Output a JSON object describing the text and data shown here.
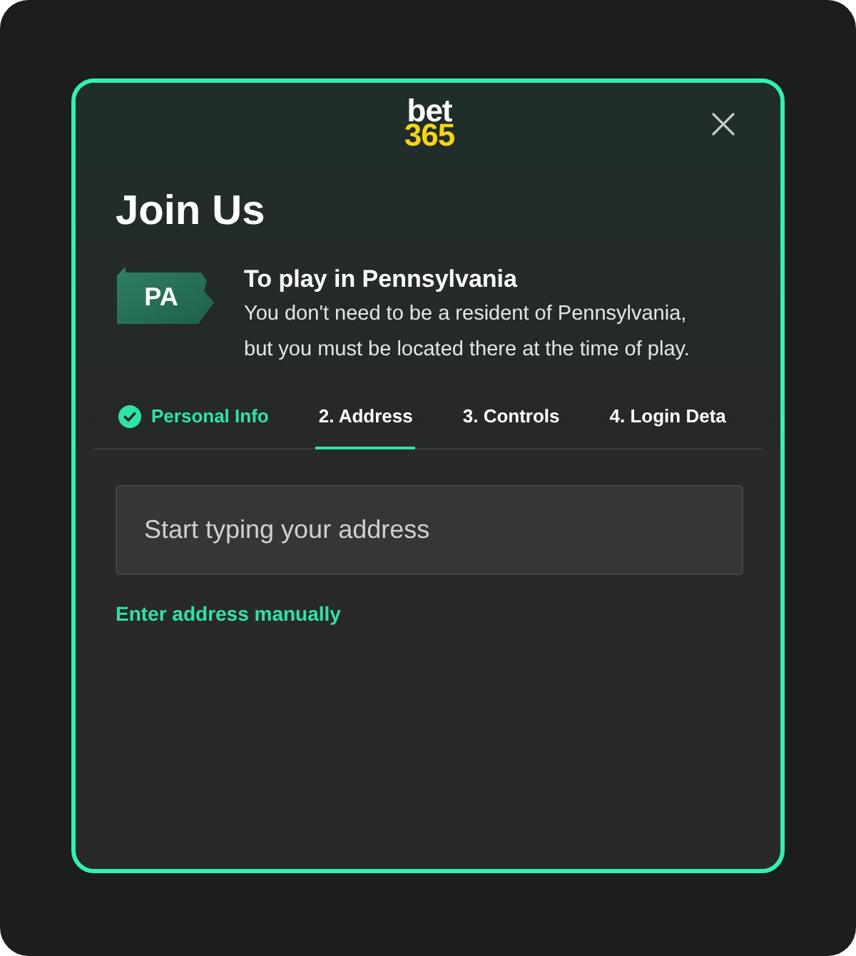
{
  "logo": {
    "line_1": "bet",
    "line_2": "365"
  },
  "title": "Join Us",
  "state_notice": {
    "badge": "PA",
    "heading": "To play in Pennsylvania",
    "text": "You don't need to be a resident of Pennsylvania, but you must be located there at the time of play."
  },
  "steps": [
    {
      "label": "Personal Info",
      "completed": true,
      "selected": false
    },
    {
      "label": "2. Address",
      "completed": false,
      "selected": true
    },
    {
      "label": "3. Controls",
      "completed": false,
      "selected": false
    },
    {
      "label": "4. Login Deta",
      "completed": false,
      "selected": false
    }
  ],
  "address_field": {
    "placeholder": "Start typing your address"
  },
  "manual_link": "Enter address manually"
}
